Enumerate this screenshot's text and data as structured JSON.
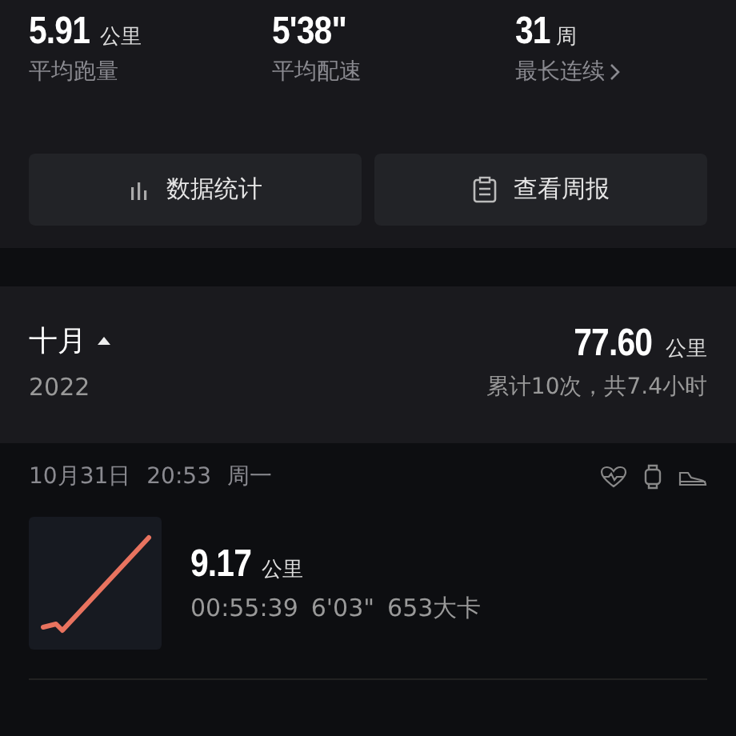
{
  "stats": [
    {
      "value": "5.91",
      "unit": "公里",
      "label": "平均跑量",
      "link": false
    },
    {
      "value": "5'38\"",
      "label": "平均配速",
      "link": false
    },
    {
      "value": "31",
      "unit": "周",
      "label": "最长连续",
      "link": true
    }
  ],
  "buttons": [
    {
      "label": "数据统计",
      "kind": "chart"
    },
    {
      "label": "查看周报",
      "kind": "report"
    }
  ],
  "month": {
    "name": "十月",
    "expanded": true,
    "year": "2022",
    "distance": "77.60",
    "unit": "公里",
    "summary": "累计10次，共7.4小时"
  },
  "records": [
    {
      "date": "10月31日",
      "time": "20:53",
      "weekday": "周一",
      "distance": "9.17",
      "unit": "公里",
      "duration": "00:55:39",
      "pace": "6'03\"",
      "calories": "653大卡"
    }
  ]
}
